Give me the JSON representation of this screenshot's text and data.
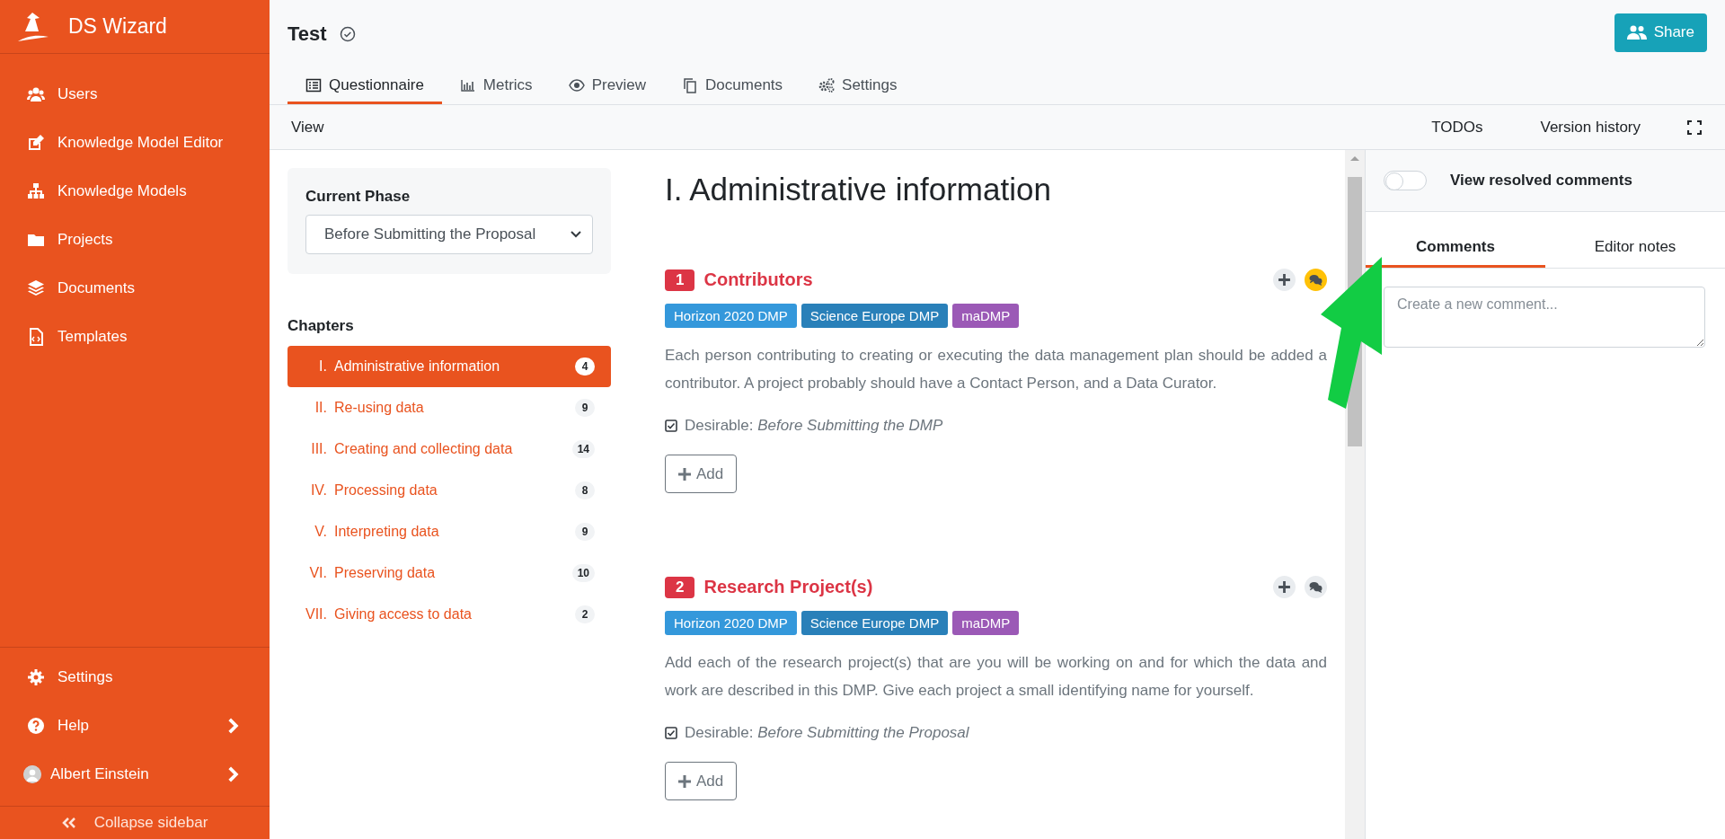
{
  "app": {
    "name": "DS Wizard"
  },
  "sidebar": {
    "items": [
      {
        "label": "Users",
        "selected": false
      },
      {
        "label": "Knowledge Model Editor",
        "selected": false
      },
      {
        "label": "Knowledge Models",
        "selected": false
      },
      {
        "label": "Projects",
        "selected": false
      },
      {
        "label": "Documents",
        "selected": false
      },
      {
        "label": "Templates",
        "selected": false
      }
    ],
    "bottom_items": [
      {
        "label": "Settings",
        "has_submenu": false
      },
      {
        "label": "Help",
        "has_submenu": true
      }
    ],
    "user": {
      "name": "Albert Einstein",
      "has_submenu": true
    },
    "collapse": {
      "label": "Collapse sidebar"
    }
  },
  "header": {
    "title": "Test",
    "share_button": {
      "label": "Share"
    },
    "tabs": [
      {
        "label": "Questionnaire",
        "selected": true
      },
      {
        "label": "Metrics",
        "selected": false
      },
      {
        "label": "Preview",
        "selected": false
      },
      {
        "label": "Documents",
        "selected": false
      },
      {
        "label": "Settings",
        "selected": false
      }
    ]
  },
  "view_bar": {
    "menu": "View",
    "items": [
      "TODOs",
      "Version history"
    ]
  },
  "phase": {
    "label": "Current Phase",
    "value": "Before Submitting the Proposal"
  },
  "chapters": {
    "heading": "Chapters",
    "items": [
      {
        "number": "I.",
        "title": "Administrative information",
        "count": "4",
        "selected": true
      },
      {
        "number": "II.",
        "title": "Re-using data",
        "count": "9",
        "selected": false
      },
      {
        "number": "III.",
        "title": "Creating and collecting data",
        "count": "14",
        "selected": false
      },
      {
        "number": "IV.",
        "title": "Processing data",
        "count": "8",
        "selected": false
      },
      {
        "number": "V.",
        "title": "Interpreting data",
        "count": "9",
        "selected": false
      },
      {
        "number": "VI.",
        "title": "Preserving data",
        "count": "10",
        "selected": false
      },
      {
        "number": "VII.",
        "title": "Giving access to data",
        "count": "2",
        "selected": false
      }
    ]
  },
  "chapter_title": "I. Administrative information",
  "questions": [
    {
      "number": "1",
      "title": "Contributors",
      "has_comments": true,
      "tags": [
        {
          "label": "Horizon 2020 DMP",
          "color": "#3498db"
        },
        {
          "label": "Science Europe DMP",
          "color": "#2980b9"
        },
        {
          "label": "maDMP",
          "color": "#9b59b6"
        }
      ],
      "text": "Each person contributing to creating or executing the data management plan should be added a contributor. A project probably should have a Contact Person, and a Data Curator.",
      "desirable": {
        "checked": true,
        "text": "Desirable: *Before Submitting the DMP*"
      },
      "add_label": "Add"
    },
    {
      "number": "2",
      "title": "Research Project(s)",
      "has_comments": false,
      "tags": [
        {
          "label": "Horizon 2020 DMP",
          "color": "#3498db"
        },
        {
          "label": "Science Europe DMP",
          "color": "#2980b9"
        },
        {
          "label": "maDMP",
          "color": "#9b59b6"
        }
      ],
      "text": "Add each of the research project(s) that are you will be working on and for which the data and work are described in this DMP. Give each project a small identifying name for yourself.",
      "desirable": {
        "checked": true,
        "text": "Desirable: *Before Submitting the Proposal*"
      },
      "add_label": "Add"
    }
  ],
  "comments_panel": {
    "toggle": {
      "label": "View resolved comments",
      "on": false
    },
    "tabs": [
      {
        "label": "Comments",
        "selected": true
      },
      {
        "label": "Editor notes",
        "selected": false
      }
    ],
    "placeholder": "Create a new comment..."
  }
}
